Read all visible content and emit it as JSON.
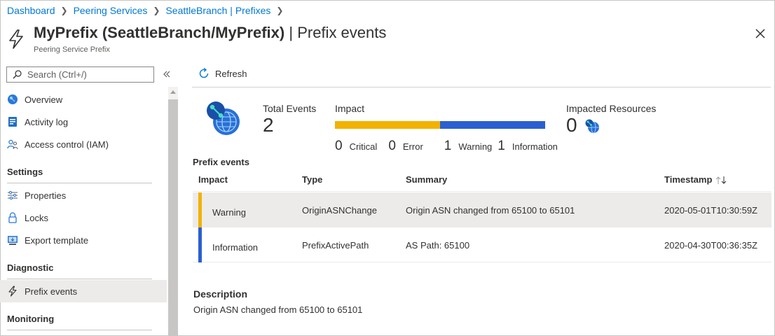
{
  "breadcrumb": [
    "Dashboard",
    "Peering Services",
    "SeattleBranch | Prefixes"
  ],
  "header": {
    "title_main": "MyPrefix (SeattleBranch/MyPrefix)",
    "title_sep": "|",
    "title_section": "Prefix events",
    "subtitle": "Peering Service Prefix"
  },
  "search": {
    "placeholder": "Search (Ctrl+/)"
  },
  "sidebar": {
    "items": [
      {
        "label": "Overview",
        "icon": "overview-icon"
      },
      {
        "label": "Activity log",
        "icon": "activity-log-icon"
      },
      {
        "label": "Access control (IAM)",
        "icon": "access-control-icon"
      }
    ],
    "sections": [
      {
        "title": "Settings",
        "items": [
          {
            "label": "Properties",
            "icon": "properties-icon"
          },
          {
            "label": "Locks",
            "icon": "lock-icon"
          },
          {
            "label": "Export template",
            "icon": "export-template-icon"
          }
        ]
      },
      {
        "title": "Diagnostic",
        "items": [
          {
            "label": "Prefix events",
            "icon": "lightning-icon",
            "active": true
          }
        ]
      },
      {
        "title": "Monitoring",
        "items": []
      }
    ]
  },
  "toolbar": {
    "refresh_label": "Refresh"
  },
  "summary": {
    "total_events_label": "Total Events",
    "total_events_value": "2",
    "impact_label": "Impact",
    "impacted_resources_label": "Impacted Resources",
    "impacted_resources_value": "0",
    "counts": [
      {
        "value": "0",
        "label": "Critical"
      },
      {
        "value": "0",
        "label": "Error"
      },
      {
        "value": "1",
        "label": "Warning"
      },
      {
        "value": "1",
        "label": "Information"
      }
    ],
    "bar_fractions": {
      "warning": 0.5,
      "information": 0.5
    }
  },
  "events": {
    "title": "Prefix events",
    "columns": [
      "Impact",
      "Type",
      "Summary",
      "Timestamp"
    ],
    "rows": [
      {
        "impact": "Warning",
        "type": "OriginASNChange",
        "summary": "Origin ASN changed from 65100 to 65101",
        "timestamp": "2020-05-01T10:30:59Z",
        "selected": true
      },
      {
        "impact": "Information",
        "type": "PrefixActivePath",
        "summary": "AS Path: 65100",
        "timestamp": "2020-04-30T00:36:35Z",
        "selected": false
      }
    ]
  },
  "description": {
    "title": "Description",
    "text": "Origin ASN changed from 65100 to 65101"
  },
  "colors": {
    "link": "#0078d4",
    "warning": "#f2b200",
    "information": "#2b5fd1",
    "selected_row": "#edebe9"
  }
}
